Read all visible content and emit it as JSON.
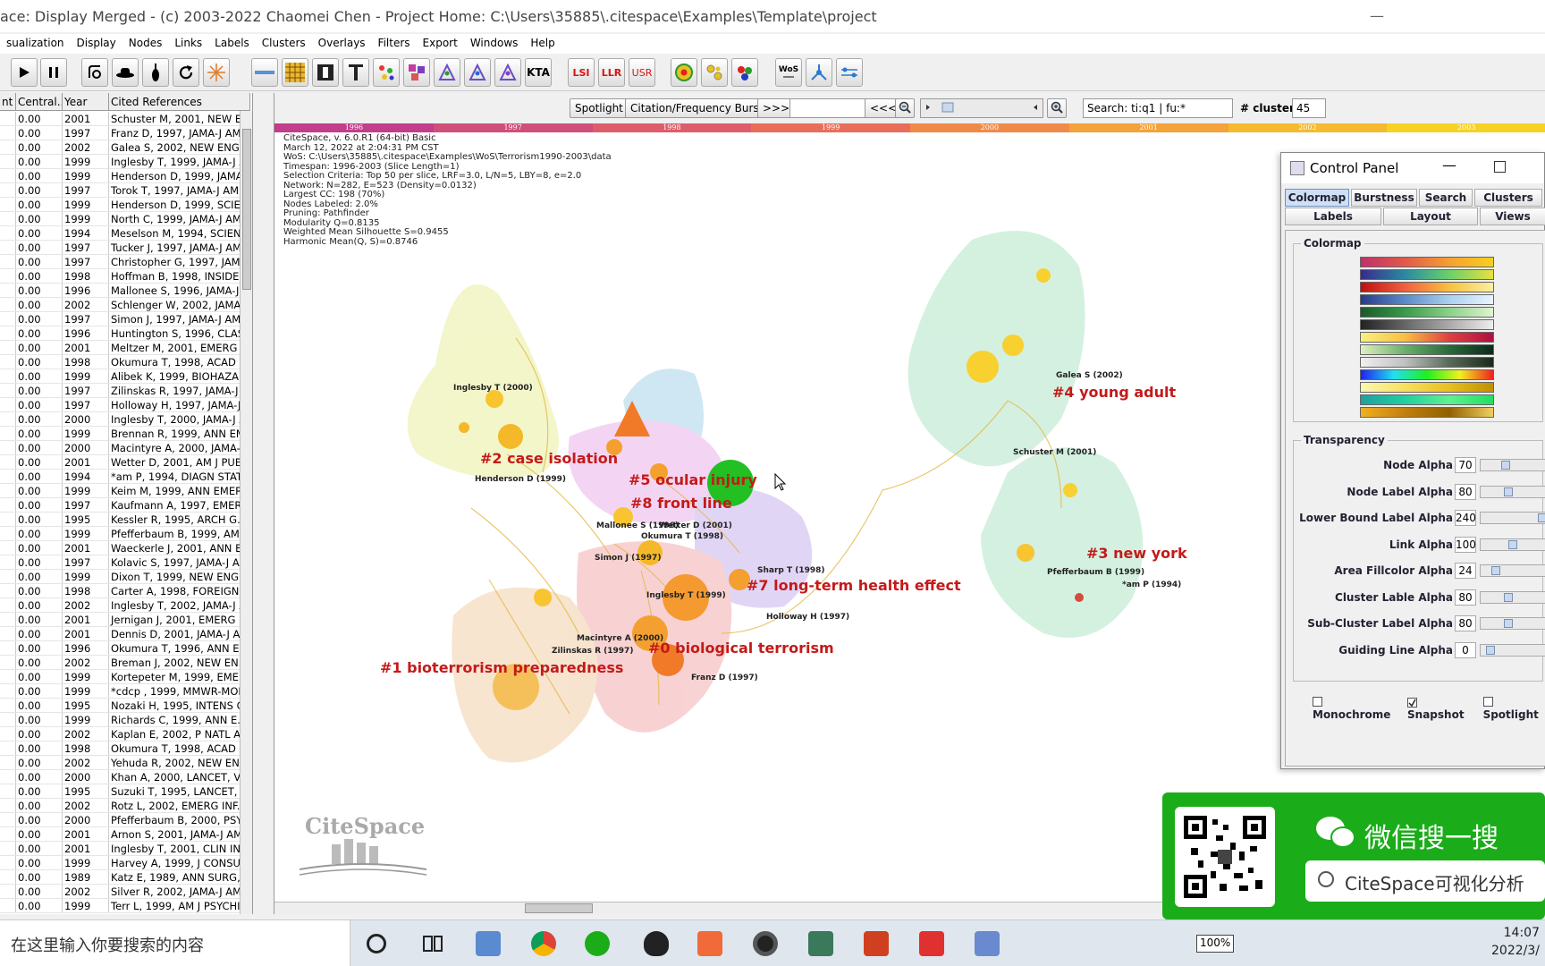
{
  "window": {
    "title": "ace: Display Merged - (c) 2003-2022 Chaomei Chen - Project Home: C:\\Users\\35885\\.citespace\\Examples\\Template\\project",
    "min_glyph": "—"
  },
  "menu": [
    "sualization",
    "Display",
    "Nodes",
    "Links",
    "Labels",
    "Clusters",
    "Overlays",
    "Filters",
    "Export",
    "Windows",
    "Help"
  ],
  "toolbar": {
    "lsi": "LSI",
    "llr": "LLR",
    "usr": "USR",
    "kta": "KTA",
    "wos": "WoS"
  },
  "table": {
    "headers": [
      "nt",
      "Central...",
      "Year",
      "Cited References"
    ],
    "rows": [
      [
        "0.00",
        "2001",
        "Schuster M, 2001, NEW E..."
      ],
      [
        "0.00",
        "1997",
        "Franz D, 1997, JAMA-J AM ..."
      ],
      [
        "0.00",
        "2002",
        "Galea S, 2002, NEW ENG..."
      ],
      [
        "0.00",
        "1999",
        "Inglesby T, 1999, JAMA-J A..."
      ],
      [
        "0.00",
        "1999",
        "Henderson D, 1999, JAMA..."
      ],
      [
        "0.00",
        "1997",
        "Torok T, 1997, JAMA-J AM ..."
      ],
      [
        "0.00",
        "1999",
        "Henderson D, 1999, SCIE..."
      ],
      [
        "0.00",
        "1999",
        "North C, 1999, JAMA-J AM ..."
      ],
      [
        "0.00",
        "1994",
        "Meselson M, 1994, SCIEN..."
      ],
      [
        "0.00",
        "1997",
        "Tucker J, 1997, JAMA-J AM..."
      ],
      [
        "0.00",
        "1997",
        "Christopher G, 1997, JAM..."
      ],
      [
        "0.00",
        "1998",
        "Hoffman B, 1998, INSIDE ..."
      ],
      [
        "0.00",
        "1996",
        "Mallonee S, 1996, JAMA-J ..."
      ],
      [
        "0.00",
        "2002",
        "Schlenger W, 2002, JAMA-..."
      ],
      [
        "0.00",
        "1997",
        "Simon J, 1997, JAMA-J AM..."
      ],
      [
        "0.00",
        "1996",
        "Huntington S, 1996, CLAS..."
      ],
      [
        "0.00",
        "2001",
        "Meltzer M, 2001, EMERG I..."
      ],
      [
        "0.00",
        "1998",
        "Okumura T, 1998, ACAD E..."
      ],
      [
        "0.00",
        "1999",
        "Alibek K, 1999, BIOHAZAR..."
      ],
      [
        "0.00",
        "1997",
        "Zilinskas R, 1997, JAMA-J ..."
      ],
      [
        "0.00",
        "1997",
        "Holloway H, 1997, JAMA-J ..."
      ],
      [
        "0.00",
        "2000",
        "Inglesby T, 2000, JAMA-J A..."
      ],
      [
        "0.00",
        "1999",
        "Brennan R, 1999, ANN EM..."
      ],
      [
        "0.00",
        "2000",
        "Macintyre A, 2000, JAMA-J ..."
      ],
      [
        "0.00",
        "2001",
        "Wetter D, 2001, AM J PUB..."
      ],
      [
        "0.00",
        "1994",
        "*am P, 1994, DIAGN STAT..."
      ],
      [
        "0.00",
        "1999",
        "Keim M, 1999, ANN EMER..."
      ],
      [
        "0.00",
        "1997",
        "Kaufmann A, 1997, EMER..."
      ],
      [
        "0.00",
        "1995",
        "Kessler R, 1995, ARCH G..."
      ],
      [
        "0.00",
        "1999",
        "Pfefferbaum B, 1999, AM J..."
      ],
      [
        "0.00",
        "2001",
        "Waeckerle J, 2001, ANN E..."
      ],
      [
        "0.00",
        "1997",
        "Kolavic S, 1997, JAMA-J A..."
      ],
      [
        "0.00",
        "1999",
        "Dixon T, 1999, NEW ENGL..."
      ],
      [
        "0.00",
        "1998",
        "Carter A, 1998, FOREIGN ..."
      ],
      [
        "0.00",
        "2002",
        "Inglesby T, 2002, JAMA-J A..."
      ],
      [
        "0.00",
        "2001",
        "Jernigan J, 2001, EMERG ..."
      ],
      [
        "0.00",
        "2001",
        "Dennis D, 2001, JAMA-J A..."
      ],
      [
        "0.00",
        "1996",
        "Okumura T, 1996, ANN E..."
      ],
      [
        "0.00",
        "2002",
        "Breman J, 2002, NEW EN..."
      ],
      [
        "0.00",
        "1999",
        "Kortepeter M, 1999, EMER..."
      ],
      [
        "0.00",
        "1999",
        "*cdcp , 1999, MMWR-MOR..."
      ],
      [
        "0.00",
        "1995",
        "Nozaki H, 1995, INTENS C..."
      ],
      [
        "0.00",
        "1999",
        "Richards C, 1999, ANN E..."
      ],
      [
        "0.00",
        "2002",
        "Kaplan E, 2002, P NATL A..."
      ],
      [
        "0.00",
        "1998",
        "Okumura T, 1998, ACAD E..."
      ],
      [
        "0.00",
        "2002",
        "Yehuda R, 2002, NEW EN..."
      ],
      [
        "0.00",
        "2000",
        "Khan A, 2000, LANCET, V..."
      ],
      [
        "0.00",
        "1995",
        "Suzuki T, 1995, LANCET, ..."
      ],
      [
        "0.00",
        "2002",
        "Rotz L, 2002, EMERG INF..."
      ],
      [
        "0.00",
        "2000",
        "Pfefferbaum B, 2000, PSY..."
      ],
      [
        "0.00",
        "2001",
        "Arnon S, 2001, JAMA-J AM ..."
      ],
      [
        "0.00",
        "2001",
        "Inglesby T, 2001, CLIN IN..."
      ],
      [
        "0.00",
        "1999",
        "Harvey A, 1999, J CONSU..."
      ],
      [
        "0.00",
        "1989",
        "Katz E, 1989, ANN SURG, ..."
      ],
      [
        "0.00",
        "2002",
        "Silver R, 2002, JAMA-J AM ..."
      ],
      [
        "0.00",
        "1999",
        "Terr L, 1999, AM J PSYCHI..."
      ]
    ]
  },
  "netbar": {
    "spotlight": "Spotlight",
    "burst": "Citation/Frequency Burst",
    "fwd": ">>>",
    "back": "<<<",
    "search_value": "Search: ti:q1 | fu:*",
    "clusters_label": "# clusters",
    "clusters_value": "45"
  },
  "timeline": [
    "1996",
    "1997",
    "1998",
    "1999",
    "2000",
    "2001",
    "2002",
    "2003"
  ],
  "info": [
    "CiteSpace, v. 6.0.R1 (64-bit) Basic",
    "March 12, 2022 at 2:04:31 PM CST",
    "WoS: C:\\Users\\35885\\.citespace\\Examples\\WoS\\Terrorism1990-2003\\data",
    "Timespan: 1996-2003 (Slice Length=1)",
    "Selection Criteria: Top 50 per slice, LRF=3.0, L/N=5, LBY=8, e=2.0",
    "Network: N=282, E=523 (Density=0.0132)",
    "Largest CC: 198 (70%)",
    "Nodes Labeled: 2.0%",
    "Pruning: Pathfinder",
    "Modularity Q=0.8135",
    "Weighted Mean Silhouette S=0.9455",
    "Harmonic Mean(Q, S)=0.8746"
  ],
  "clusters": [
    "#0 biological terrorism",
    "#1 bioterrorism preparedness",
    "#2 case isolation",
    "#3 new york",
    "#4 young adult",
    "#5 ocular injury",
    "#7 long-term health effect",
    "#8 front line"
  ],
  "node_labels": [
    "Inglesby T (2000)",
    "Henderson D (1999)",
    "Mallonee S (1996)",
    "Wetter D (2001)",
    "Okumura T (1998)",
    "Simon J (1997)",
    "Sharp T (1998)",
    "Inglesby T (1999)",
    "Holloway H (1997)",
    "Macintyre A (2000)",
    "Zilinskas R (1997)",
    "Franz D (1997)",
    "Galea S (2002)",
    "Schuster M (2001)",
    "Pfefferbaum B (1999)",
    "*am P (1994)"
  ],
  "logo": "CiteSpace",
  "control_panel": {
    "title": "Control Panel",
    "tabs": [
      "Colormap",
      "Burstness",
      "Search",
      "Clusters",
      "Labels",
      "Layout",
      "Views"
    ],
    "colormap_label": "Colormap",
    "transparency_label": "Transparency",
    "transparency": [
      {
        "label": "Node Alpha",
        "value": "70",
        "level": 0.28
      },
      {
        "label": "Node Label Alpha",
        "value": "80",
        "level": 0.32
      },
      {
        "label": "Lower Bound Label Alpha",
        "value": "240",
        "level": 0.94
      },
      {
        "label": "Link Alpha",
        "value": "100",
        "level": 0.4
      },
      {
        "label": "Area Fillcolor Alpha",
        "value": "24",
        "level": 0.1
      },
      {
        "label": "Cluster Lable Alpha",
        "value": "80",
        "level": 0.32
      },
      {
        "label": "Sub-Cluster Label Alpha",
        "value": "80",
        "level": 0.32
      },
      {
        "label": "Guiding Line Alpha",
        "value": "0",
        "level": 0.0
      }
    ],
    "checks": [
      {
        "label": "Monochrome",
        "checked": false
      },
      {
        "label": "Snapshot",
        "checked": true
      },
      {
        "label": "Spotlight",
        "checked": false
      }
    ]
  },
  "wechat": {
    "line1": "微信搜一搜",
    "search": "CiteSpace可视化分析"
  },
  "taskbar": {
    "search_placeholder": "在这里输入你要搜索的内容",
    "battery": "100%",
    "time": "14:07",
    "date": "2022/3/"
  },
  "colors": {
    "accent_green": "#1aad19",
    "cluster_label": "#c41a1a"
  }
}
